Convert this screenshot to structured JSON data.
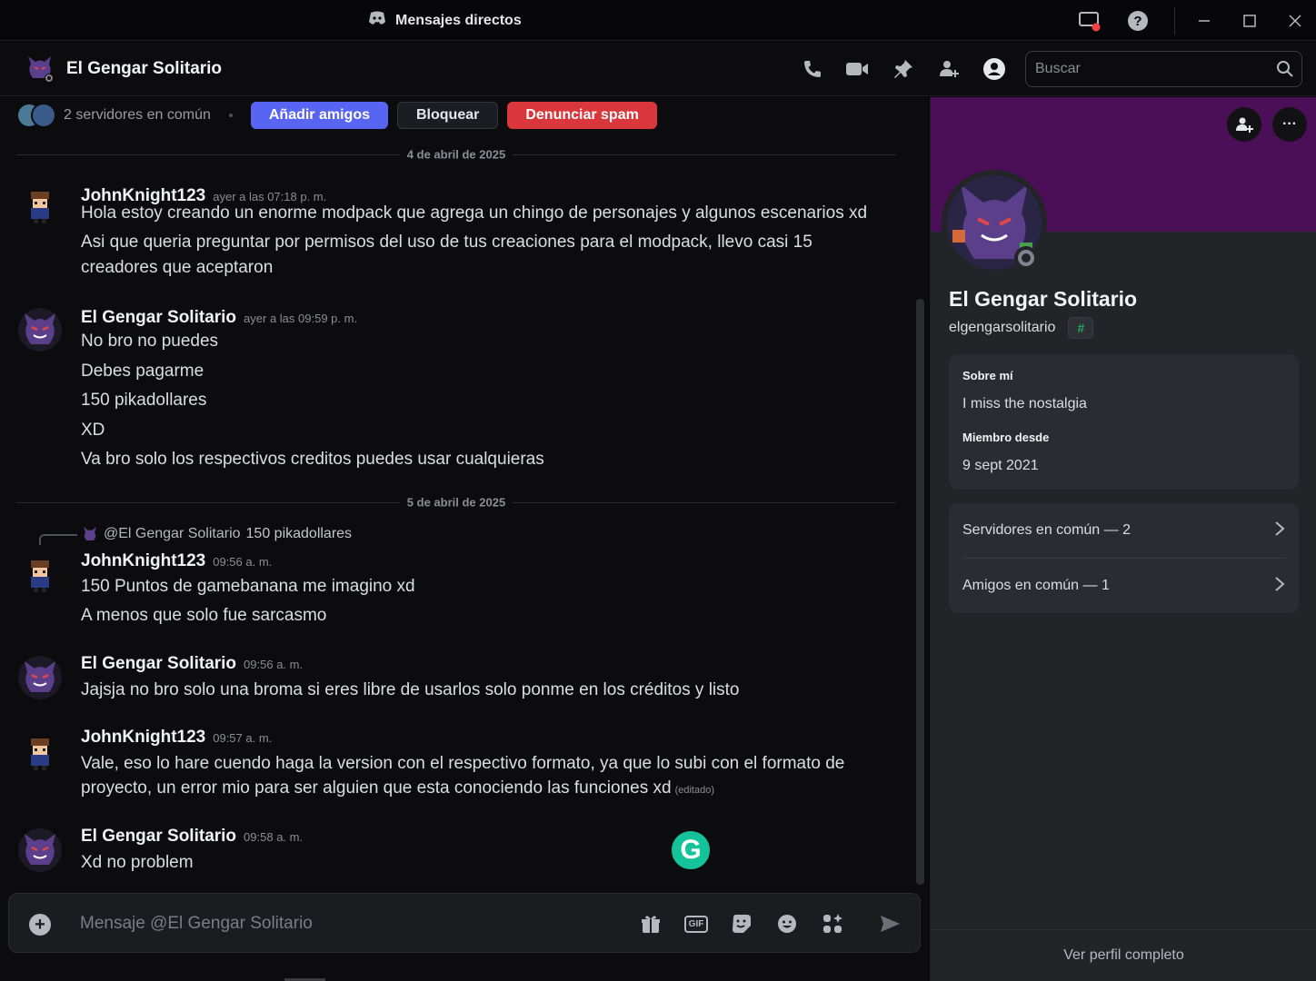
{
  "window": {
    "title": "Mensajes directos"
  },
  "header": {
    "title": "El Gengar Solitario",
    "search_placeholder": "Buscar"
  },
  "friendbar": {
    "mutual_servers": "2 servidores en común",
    "add_friend": "Añadir amigos",
    "block": "Bloquear",
    "report_spam": "Denunciar spam"
  },
  "dividers": [
    "4 de abril de 2025",
    "5 de abril de 2025"
  ],
  "messages": [
    {
      "author": "JohnKnight123",
      "time": "ayer a las 07:18 p. m.",
      "lines": [
        "Hola estoy creando un enorme modpack que agrega un chingo de personajes y algunos escenarios xd",
        "Asi que queria preguntar por permisos del uso de tus creaciones para el modpack, llevo casi 15",
        "creadores que aceptaron"
      ]
    },
    {
      "author": "El Gengar Solitario",
      "time": "ayer a las 09:59 p. m.",
      "lines": [
        "No bro no puedes",
        "Debes pagarme",
        "150 pikadollares",
        "XD",
        "Va bro solo los respectivos creditos puedes usar cualquieras"
      ]
    },
    {
      "author": "JohnKnight123",
      "time": "09:56 a. m.",
      "reply_to": "@El Gengar Solitario",
      "reply_text": "150 pikadollares",
      "lines": [
        "150 Puntos de gamebanana me imagino xd",
        "A menos que solo fue sarcasmo"
      ]
    },
    {
      "author": "El Gengar Solitario",
      "time": "09:56 a. m.",
      "lines": [
        "Jajsja no bro solo una broma si eres libre de usarlos solo ponme en los créditos y listo"
      ]
    },
    {
      "author": "JohnKnight123",
      "time": "09:57 a. m.",
      "lines": [
        "Vale, eso lo hare cuendo haga la version con el respectivo formato, ya que lo subi con el formato de",
        "proyecto, un error mio para ser alguien que esta conociendo las funciones xd"
      ],
      "edited": "(editado)"
    },
    {
      "author": "El Gengar Solitario",
      "time": "09:58 a. m.",
      "lines": [
        "Xd no problem"
      ]
    }
  ],
  "composer": {
    "placeholder": "Mensaje @El Gengar Solitario",
    "gif_label": "GIF"
  },
  "grammarly_letter": "G",
  "profile": {
    "name": "El Gengar Solitario",
    "username": "elgengarsolitario",
    "tag": "#",
    "about_label": "Sobre mí",
    "about_text": "I miss the nostalgia",
    "member_label": "Miembro desde",
    "member_since": "9 sept 2021",
    "mutual_servers": "Servidores en común — 2",
    "mutual_friends": "Amigos en común — 1",
    "view_full": "Ver perfil completo",
    "more_label": "···"
  },
  "colors": {
    "accent": "#5865f2",
    "danger": "#da373c",
    "banner": "#4b0f57",
    "online_status": "#80848e"
  },
  "icons": [
    "discord-icon",
    "screen-share-icon",
    "help-icon",
    "minimize-icon",
    "maximize-icon",
    "close-icon",
    "phone-icon",
    "video-icon",
    "pin-icon",
    "add-member-icon",
    "profile-icon",
    "search-icon",
    "plus-icon",
    "gift-icon",
    "gif-icon",
    "sticker-icon",
    "emoji-icon",
    "apps-icon",
    "send-icon",
    "chevron-right-icon"
  ]
}
